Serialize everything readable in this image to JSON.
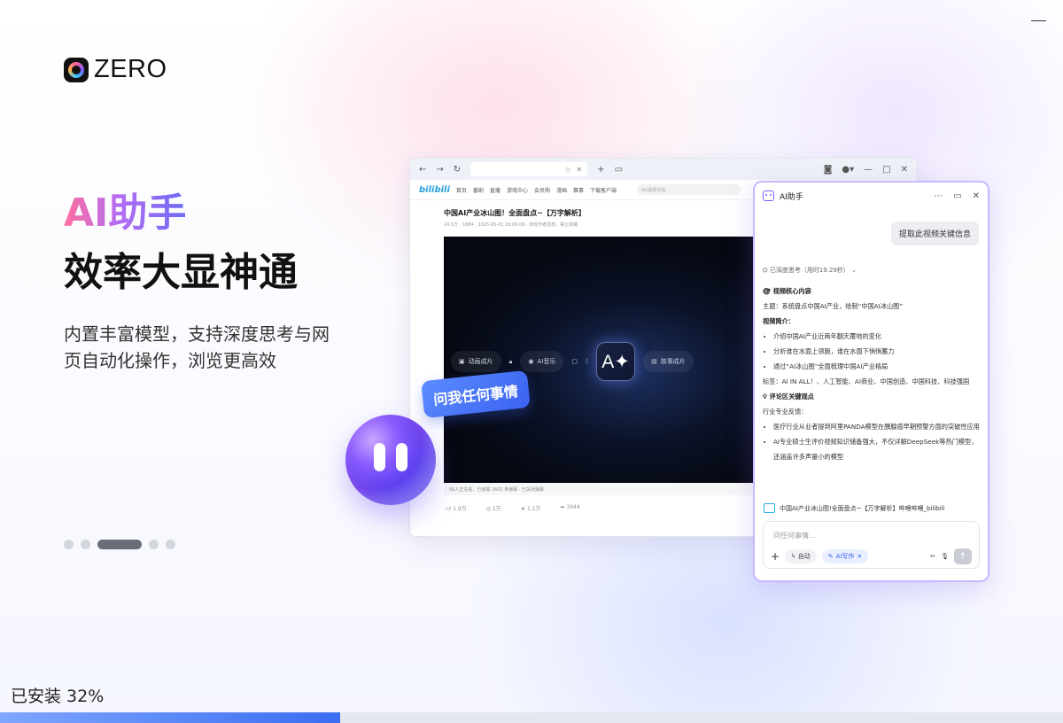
{
  "window": {
    "minimize_icon": "minimize-icon"
  },
  "logo": {
    "text": "ZERO"
  },
  "hero": {
    "title": "AI助手",
    "subtitle": "效率大显神通",
    "description": "内置丰富模型，支持深度思考与网页自动化操作，浏览更高效"
  },
  "carousel": {
    "count": 5,
    "active_index": 2
  },
  "install": {
    "status": "已安装 32%",
    "progress": 0.32
  },
  "browser": {
    "nav_items": [
      "首页",
      "番剧",
      "直播",
      "游戏中心",
      "会员购",
      "漫画",
      "赛事"
    ],
    "site_logo": "bilibili",
    "download": "下载客户端",
    "search_placeholder": "NG最新动态",
    "video_title": "中国AI产业冰山图！全面盘点~【万字解析】",
    "video_meta": "24.5万   ·   1684   ·   2025-05-01 16:06:06   ·   未经作者授权，禁止转载",
    "toolbar": {
      "item1": "动画成片",
      "item2": "AI音乐",
      "ai_button": "A✦",
      "item3": "故事成片"
    },
    "danmaku_bar": "56人正在看，已装载 1602 条弹幕   ·   已关闭弹幕",
    "actions": [
      "1.9万",
      "1万",
      "1.1万",
      "3044"
    ],
    "badge": "问我任何事情"
  },
  "assistant": {
    "title": "AI助手",
    "user_message": "提取此视频关键信息",
    "thinking": "已深度思考（用时19.29秒）",
    "answer": {
      "section1": "视频核心内容",
      "topic": "主题：系统盘点中国AI产业，绘制“中国AI冰山图”",
      "summary_title": "视频简介：",
      "bullets1": [
        "介绍中国AI产业近两年翻天覆地的变化",
        "分析谁在水面上领跑，谁在水面下悄悄蓄力",
        "通过“AI冰山图”全面梳理中国AI产业格局"
      ],
      "tags": "标签：AI IN ALL！、人工智能、AI商业、中国创造、中国科技、科技强国",
      "section2": "评论区关键观点",
      "feedback_title": "行业专业反馈：",
      "bullets2": [
        "医疗行业从业者提到阿里PANDA模型在胰腺癌早期预警方面的突破性应用",
        "AI专业硕士生评价视频知识储备强大，不仅详解DeepSeek等热门模型，还涵盖许多声量小的模型"
      ]
    },
    "reference": "中国AI产业冰山图!全面盘点~【万字解析】哔哩哔哩_bilibili",
    "input_placeholder": "问任何事情...",
    "chip_auto": "自动",
    "chip_write": "AI写作"
  }
}
